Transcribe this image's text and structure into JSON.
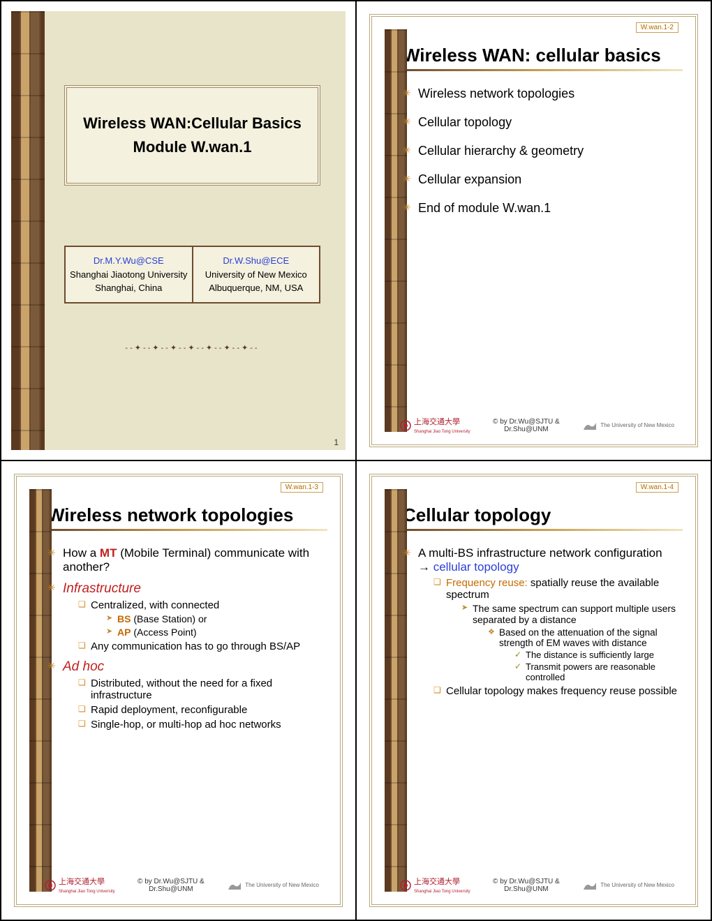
{
  "slide1": {
    "title_line1": "Wireless WAN:Cellular Basics",
    "title_line2": "Module W.wan.1",
    "author1_email": "Dr.M.Y.Wu@CSE",
    "author1_org": "Shanghai Jiaotong University",
    "author1_loc": "Shanghai, China",
    "author2_email": "Dr.W.Shu@ECE",
    "author2_org": "University of New Mexico",
    "author2_loc": "Albuquerque, NM, USA",
    "decoration": "--✦--✦--✦--✦--✦--✦--✦--",
    "pagenum": "1"
  },
  "slide2": {
    "badge": "W.wan.1-2",
    "title": "Wireless WAN: cellular basics",
    "items": [
      "Wireless network topologies",
      "Cellular topology",
      "Cellular hierarchy & geometry",
      "Cellular expansion",
      "End of module W.wan.1"
    ]
  },
  "slide3": {
    "badge": "W.wan.1-3",
    "title": "Wireless network topologies",
    "q_pre": "How a ",
    "q_mt": "MT",
    "q_post": " (Mobile Terminal) communicate with another?",
    "infra_label": "Infrastructure",
    "infra_sub1": "Centralized, with connected",
    "infra_sub1a_strong": "BS",
    "infra_sub1a_rest": " (Base Station) or",
    "infra_sub1b_strong": "AP",
    "infra_sub1b_rest": " (Access Point)",
    "infra_sub2": "Any communication has to go through BS/AP",
    "adhoc_label": "Ad hoc",
    "adhoc_sub1": "Distributed, without the need for a fixed infrastructure",
    "adhoc_sub2": "Rapid deployment, reconfigurable",
    "adhoc_sub3": "Single-hop, or multi-hop ad hoc networks"
  },
  "slide4": {
    "badge": "W.wan.1-4",
    "title": "Cellular topology",
    "l1": "A multi-BS infrastructure network configuration",
    "l1_arrow": "→",
    "l1_blue": " cellular topology",
    "l2_orange": "Frequency reuse:",
    "l2_rest": " spatially reuse the available spectrum",
    "l3": "The same spectrum can support multiple users separated by a distance",
    "l4": "Based on the attenuation of the signal strength of EM waves with distance",
    "l5a": "The distance is sufficiently large",
    "l5b": "Transmit powers are reasonable controlled",
    "l2b": "Cellular topology makes frequency reuse possible"
  },
  "footer": {
    "left_text": "上海交通大學",
    "left_sub": "Shanghai Jiao Tong University",
    "center": "© by Dr.Wu@SJTU & Dr.Shu@UNM",
    "right_text": "The University of New Mexico"
  }
}
